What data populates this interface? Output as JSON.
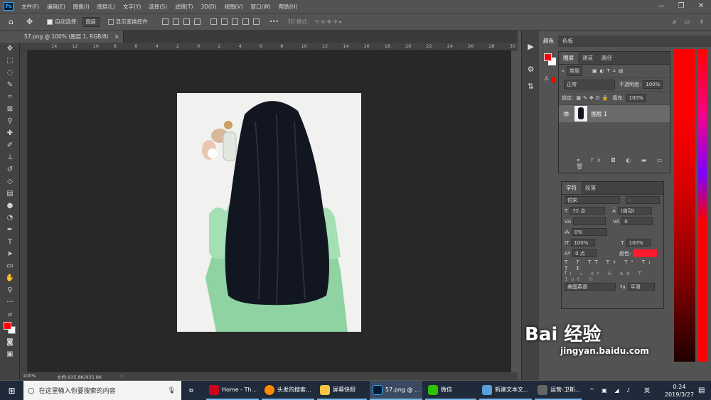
{
  "app": {
    "logo": "Ps"
  },
  "menu": [
    "文件(F)",
    "编辑(E)",
    "图像(I)",
    "图层(L)",
    "文字(Y)",
    "选择(S)",
    "滤镜(T)",
    "3D(D)",
    "视图(V)",
    "窗口(W)",
    "帮助(H)"
  ],
  "options": {
    "auto_select_label": "自动选择:",
    "auto_select_value": "图层",
    "show_transform_label": "显示变换控件",
    "mode_3d": "3D 模式:"
  },
  "document": {
    "tab_title": "57.png @ 100% (图层 1, RGB/8)"
  },
  "ruler_top": [
    "14",
    "12",
    "10",
    "8",
    "6",
    "4",
    "2",
    "0",
    "2",
    "4",
    "6",
    "8",
    "10",
    "12",
    "14",
    "16",
    "18",
    "20",
    "22",
    "24",
    "26",
    "28",
    "30"
  ],
  "status": {
    "zoom": "100%",
    "doc_info": "文档:935.8K/935.8K"
  },
  "color_panel": {
    "tabs": [
      "颜色",
      "色板"
    ],
    "fg": "#ff0000",
    "bg": "#ffffff"
  },
  "layers": {
    "tabs": [
      "图层",
      "通道",
      "路径"
    ],
    "filter": "类型",
    "blend_mode": "正常",
    "opacity_label": "不透明度:",
    "opacity": "100%",
    "lock_label": "锁定:",
    "fill_label": "填充:",
    "fill": "100%",
    "layer_name": "图层 1"
  },
  "character": {
    "tabs": [
      "字符",
      "段落"
    ],
    "font_family": "仿宋",
    "font_style": "-",
    "size": "72 点",
    "leading": "(自动)",
    "tracking": "0",
    "scale_pct": "0%",
    "vscale": "100%",
    "hscale": "100%",
    "baseline": "0 点",
    "color_label": "颜色:",
    "color": "#ff1a2e",
    "language": "美国英语",
    "aa_label": "a",
    "antialias": "平滑"
  },
  "taskbar": {
    "search_placeholder": "在这里输入你要搜索的内容",
    "items": [
      "Home - Th...",
      "头发的搜索...",
      "屏幕快照",
      "57.png @ ...",
      "微信",
      "新建文本文...",
      "运营-卫斯..."
    ],
    "time": "0:24",
    "date": "2019/3/27",
    "ime": "英"
  },
  "watermark": {
    "brand": "Bai 经验",
    "url": "jingyan.baidu.com"
  }
}
